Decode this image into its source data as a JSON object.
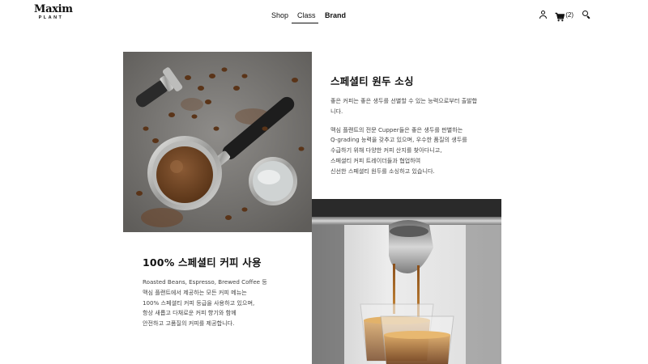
{
  "header": {
    "logo": {
      "main": "Maxim",
      "sub": "PLANT"
    },
    "nav": {
      "shop": "Shop",
      "class": "Class",
      "brand": "Brand",
      "active": "Class"
    },
    "util": {
      "user_icon": "user-icon",
      "cart_icon": "cart-icon",
      "cart_count": "(2)",
      "search_icon": "search-icon"
    }
  },
  "sections": {
    "sourcing": {
      "title": "스페셜티 원두 소싱",
      "body": [
        "좋은 커피는 좋은 생두를 선별할 수 있는 능력으로부터 출발합",
        "니다.",
        "",
        "맥심 플랜트의 전문 Cupper들은 좋은 생두를 판별하는",
        "Q-grading 능력을 갖추고 있으며, 우수한 품질의 생두를",
        "수급하기 위해 다양한 커피 산지를 찾아다니고,",
        "스페셜티 커피 트레이더들과 협업하여",
        "신선한 스페셜티 원두를 소싱하고 있습니다."
      ]
    },
    "usage": {
      "title": "100% 스페셜티 커피 사용",
      "body": [
        "Roasted Beans, Espresso, Brewed Coffee 등",
        "맥심 플랜트에서 제공하는 모든 커피 메뉴는",
        "100% 스페셜티 커피 등급을 사용하고 있으며,",
        "항상 새롭고 다채로운 커피 향기와 함께",
        "안전하고 고품질의 커피를 제공합니다."
      ]
    }
  },
  "colors": {
    "text": "#111111",
    "body_text": "#444444",
    "background": "#ffffff"
  }
}
